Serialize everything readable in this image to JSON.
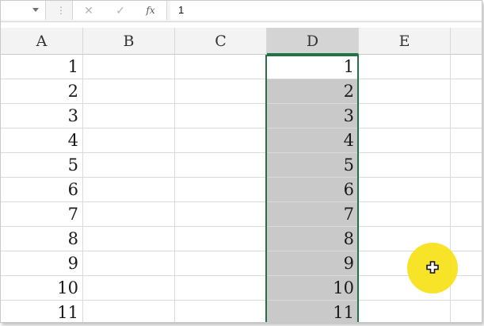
{
  "formula_bar": {
    "formula_value": "1",
    "cancel_icon": "✕",
    "enter_icon": "✓",
    "fx_label": "fx"
  },
  "columns": [
    {
      "label": "A",
      "selected": false
    },
    {
      "label": "B",
      "selected": false
    },
    {
      "label": "C",
      "selected": false
    },
    {
      "label": "D",
      "selected": true
    },
    {
      "label": "E",
      "selected": false
    }
  ],
  "rows": [
    {
      "a": "1",
      "d": "1"
    },
    {
      "a": "2",
      "d": "2"
    },
    {
      "a": "3",
      "d": "3"
    },
    {
      "a": "4",
      "d": "4"
    },
    {
      "a": "5",
      "d": "5"
    },
    {
      "a": "6",
      "d": "6"
    },
    {
      "a": "7",
      "d": "7"
    },
    {
      "a": "8",
      "d": "8"
    },
    {
      "a": "9",
      "d": "9"
    },
    {
      "a": "10",
      "d": "10"
    },
    {
      "a": "11",
      "d": "11"
    }
  ],
  "selection": {
    "active_cell_row": 0,
    "accent_color": "#217346",
    "selected_fill": "#c9c9c9"
  },
  "cursor": {
    "icon": "cell-select-cross-icon",
    "highlight_color": "#f7e11b"
  }
}
